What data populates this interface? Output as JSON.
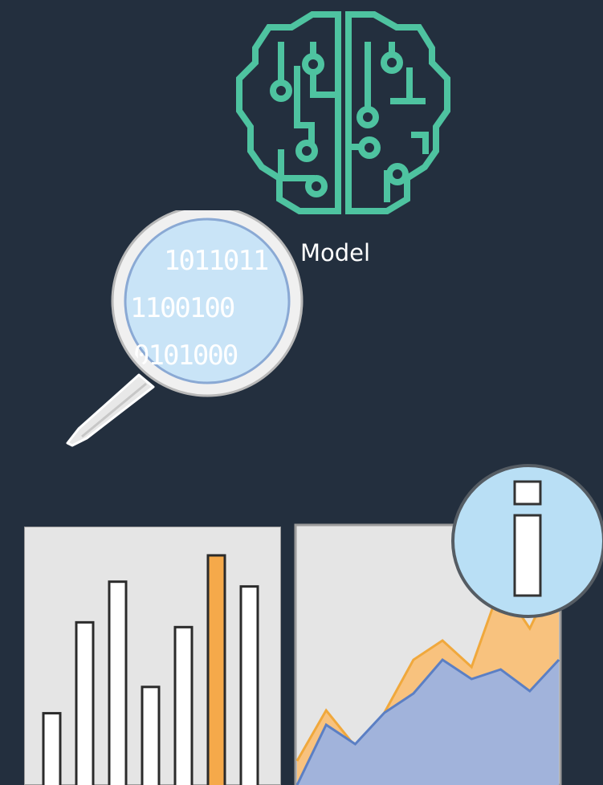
{
  "model": {
    "label": "Model",
    "icon": "brain-circuit-icon",
    "color": "#4ec3a0"
  },
  "data_search": {
    "icon": "magnifying-glass-icon",
    "binary_rows": [
      "1011011",
      "1100100",
      "0101000"
    ]
  },
  "bar_chart_icon": {
    "icon": "bar-chart-icon",
    "values": [
      30,
      68,
      85,
      41,
      66,
      96,
      83
    ],
    "highlight_index": 5,
    "bar_color": "#ffffff",
    "highlight_color": "#f5a94a"
  },
  "area_chart_icon": {
    "icon": "area-chart-icon",
    "series": [
      {
        "values": [
          10,
          31,
          16,
          30,
          52,
          60,
          49,
          83,
          65,
          90
        ]
      },
      {
        "values": [
          0,
          25,
          17,
          30,
          38,
          52,
          44,
          48,
          39,
          52
        ]
      }
    ],
    "colors": [
      "#f8c27e",
      "#a1b3db"
    ]
  },
  "info_badge": {
    "icon": "info-icon",
    "color": "#b9dff5"
  }
}
